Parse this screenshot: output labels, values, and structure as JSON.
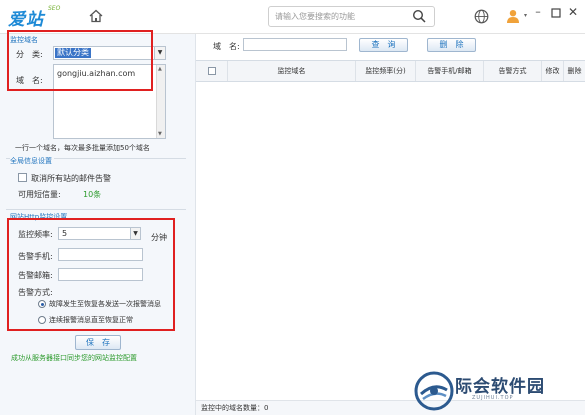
{
  "header": {
    "logo_main": "爱站",
    "logo_sub": "SEO",
    "search_placeholder": "请输入您要搜索的功能"
  },
  "left": {
    "section_monitor_domain": "监控域名",
    "category_label": "分　类:",
    "category_value": "默认分类",
    "domain_label": "域　名:",
    "domain_value": "gongjiu.aizhan.com",
    "domain_hint": "一行一个域名，每次最多批量添加50个域名",
    "section_global": "全局信息设置",
    "cancel_alert_label": "取消所有站的邮件告警",
    "sms_label": "可用短信量:",
    "sms_value": "10条",
    "section_http": "网站Http监控设置",
    "freq_label": "监控频率:",
    "freq_value": "5",
    "freq_unit": "分钟",
    "phone_label": "告警手机:",
    "email_label": "告警邮箱:",
    "method_label": "告警方式:",
    "method_option_1": "故障发生至恢复各发送一次报警消息",
    "method_option_2": "连续报警消息直至恢复正常",
    "save_label": "保　存",
    "sync_link": "成功从服务器接口同步您的网站监控配置"
  },
  "right": {
    "filter_domain_label": "域　名:",
    "query_label": "查　询",
    "delete_label": "删　除",
    "columns": [
      "监控域名",
      "监控频率(分)",
      "告警手机/邮箱",
      "告警方式",
      "修改",
      "删除"
    ],
    "status_label": "监控中的域名数量：0"
  },
  "watermark": {
    "text": "际会软件园",
    "sub": "ZUJIHUI.TOP"
  }
}
